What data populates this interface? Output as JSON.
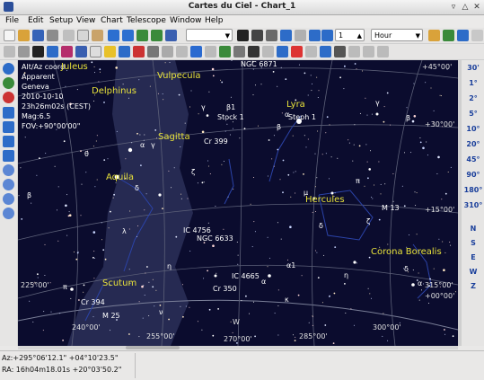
{
  "window": {
    "title": "Cartes du Ciel - Chart_1"
  },
  "menu": [
    "File",
    "Edit",
    "Setup",
    "View",
    "Chart",
    "Telescope",
    "Window",
    "Help"
  ],
  "toolbar1": {
    "field_combo": "",
    "page_value": "1",
    "time_unit": "Hour"
  },
  "right_fov": [
    "30'",
    "1°",
    "2°",
    "5°",
    "10°",
    "20°",
    "45°",
    "90°",
    "180°",
    "310°"
  ],
  "right_dirs": [
    "N",
    "S",
    "E",
    "W",
    "Z"
  ],
  "info": {
    "line1": "Alt/Az coord",
    "line2": "Apparent",
    "line3": "Geneva",
    "line4": "2010-10-10",
    "line5": "23h26m02s (CEST)",
    "line6": "Mag:6.5",
    "line7": "FOV:+90°00'00\""
  },
  "constellations": [
    "Juleus",
    "Delphinus",
    "Vulpecula",
    "Lyra",
    "Sagitta",
    "Aquila",
    "Hercules",
    "Scutum",
    "Corona Borealis"
  ],
  "objects": [
    "NGC 6871",
    "Stock 1",
    "Steph 1",
    "Cr 399",
    "IC 4756",
    "NGC 6633",
    "IC 4665",
    "Cr 350",
    "Cr 394",
    "M 25",
    "M 13"
  ],
  "greek": [
    "β1",
    "γ",
    "β",
    "α",
    "γ",
    "α",
    "ζ",
    "δ",
    "θ",
    "λ",
    "η",
    "α",
    "δ",
    "μ",
    "π",
    "ζ",
    "δ",
    "β",
    "α1",
    "η",
    "κ",
    "π",
    "γ",
    "ν",
    "β",
    "α"
  ],
  "grid_labels": {
    "alt_right": [
      "+45°00'",
      "+30°00'",
      "+15°00'",
      "315°00'",
      "+00°00'"
    ],
    "az_bottom": [
      "240°00'",
      "255°00'",
      "270°00'",
      "285°00'",
      "300°00'"
    ],
    "az_left": "225°00'",
    "cardinal": "W"
  },
  "status": {
    "altaz": "Az:+295°06'12.1\" +04°10'23.5\"",
    "radec": "RA: 16h04m18.01s +20°03'50.2\""
  }
}
